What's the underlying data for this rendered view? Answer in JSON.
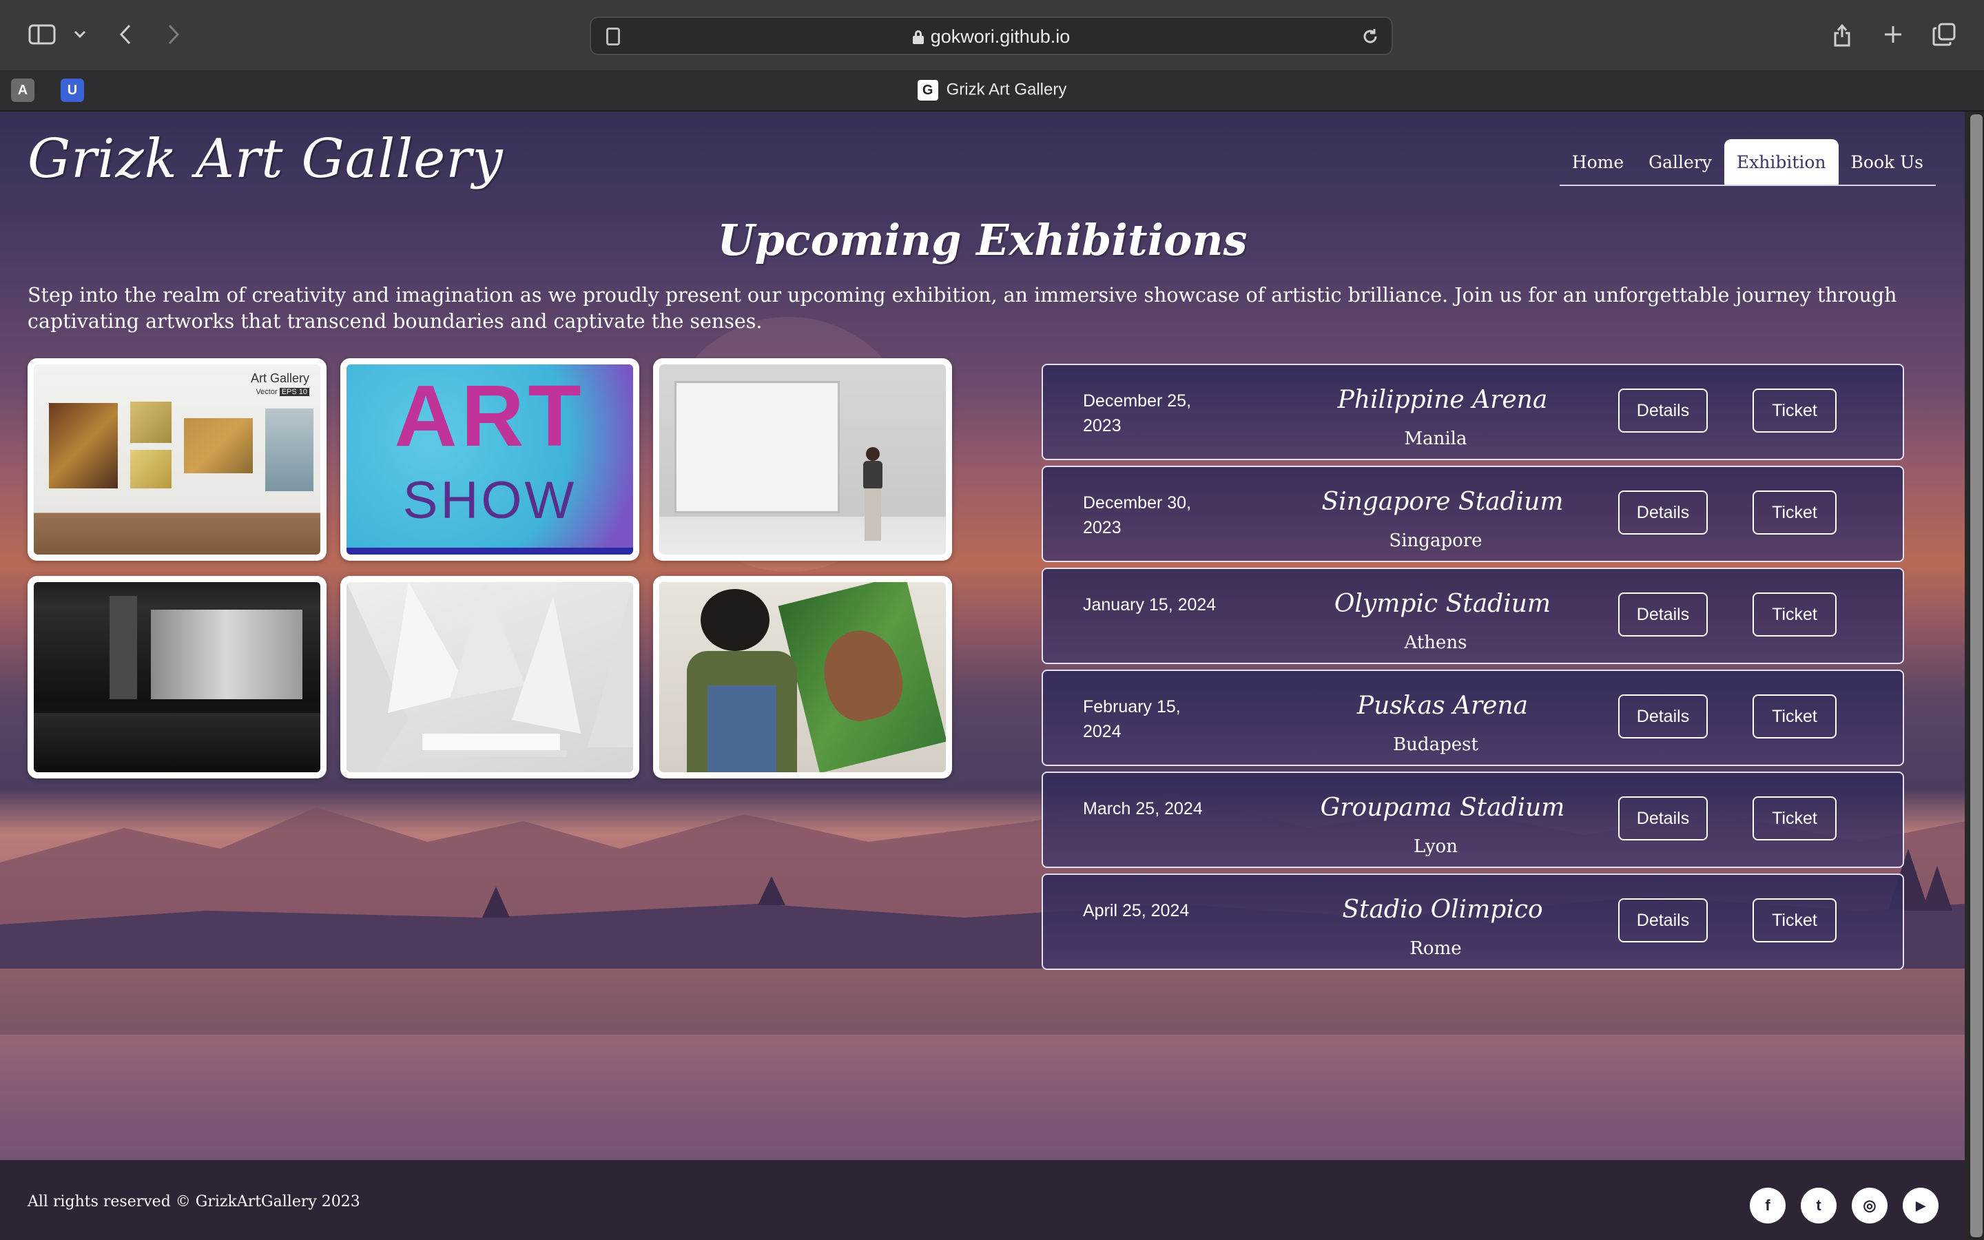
{
  "browser": {
    "url": "gokwori.github.io",
    "tab_title": "Grizk Art Gallery",
    "tab_favicon_letter": "G",
    "pinned_tabs": [
      {
        "letter": "A",
        "color": "#6b6b70"
      },
      {
        "letter": "U",
        "color": "#3b63d6"
      }
    ]
  },
  "site": {
    "title": "Grizk Art Gallery"
  },
  "nav": {
    "items": [
      "Home",
      "Gallery",
      "Exhibition",
      "Book Us"
    ],
    "active": "Exhibition"
  },
  "section": {
    "title": "Upcoming Exhibitions",
    "intro": "Step into the realm of creativity and imagination as we proudly present our upcoming exhibition, an immersive showcase of artistic brilliance. Join us for an unforgettable journey through captivating artworks that transcend boundaries and captivate the senses."
  },
  "gallery": {
    "art_gallery_label": "Art Gallery",
    "vector_label": "Vector",
    "eps_label": "EPS 10",
    "art_show_line1": "ART",
    "art_show_line2": "SHOW"
  },
  "exhibitions": [
    {
      "date": "December 25, 2023",
      "venue": "Philippine Arena",
      "city": "Manila",
      "details": "Details",
      "ticket": "Ticket"
    },
    {
      "date": "December 30, 2023",
      "venue": "Singapore Stadium",
      "city": "Singapore",
      "details": "Details",
      "ticket": "Ticket"
    },
    {
      "date": "January 15, 2024",
      "venue": "Olympic Stadium",
      "city": "Athens",
      "details": "Details",
      "ticket": "Ticket"
    },
    {
      "date": "February 15, 2024",
      "venue": "Puskas Arena",
      "city": "Budapest",
      "details": "Details",
      "ticket": "Ticket"
    },
    {
      "date": "March 25, 2024",
      "venue": "Groupama Stadium",
      "city": "Lyon",
      "details": "Details",
      "ticket": "Ticket"
    },
    {
      "date": "April 25, 2024",
      "venue": "Stadio Olimpico",
      "city": "Rome",
      "details": "Details",
      "ticket": "Ticket"
    }
  ],
  "footer": {
    "copyright": "All rights reserved © GrizkArtGallery 2023",
    "social": [
      {
        "name": "facebook-icon",
        "glyph": "f"
      },
      {
        "name": "twitter-icon",
        "glyph": "t"
      },
      {
        "name": "instagram-icon",
        "glyph": "◎"
      },
      {
        "name": "youtube-icon",
        "glyph": "▶"
      }
    ]
  },
  "colors": {
    "accent": "#3b3563",
    "footer_bg": "#2d2436"
  }
}
